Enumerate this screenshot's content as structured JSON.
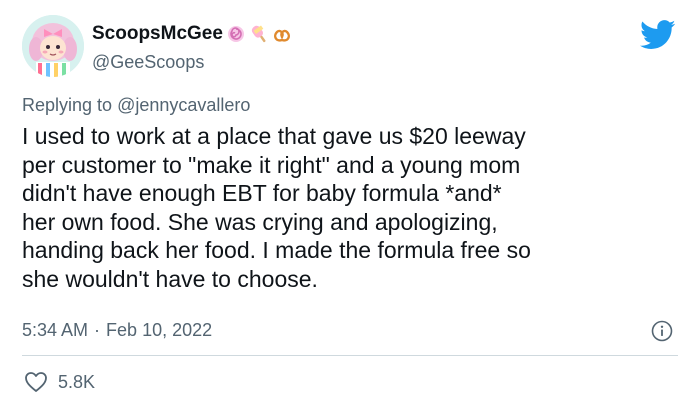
{
  "author": {
    "display_name": "ScoopsMcGee",
    "handle": "@GeeScoops",
    "name_emojis": [
      "lollipop-swirl-icon",
      "ice-pop-icon",
      "pretzel-icon"
    ]
  },
  "reply": {
    "prefix": "Replying to",
    "mention": "@jennycavallero"
  },
  "tweet": {
    "text": "I used to work at a place that gave us $20 leeway\nper customer to \"make it right\" and a young mom\ndidn't have enough EBT for baby formula *and*\nher own food. She was crying and apologizing,\nhanding back her food. I made the formula free so\nshe wouldn't have to choose.",
    "time": "5:34 AM",
    "separator": "·",
    "date": "Feb 10, 2022"
  },
  "engagement": {
    "likes": "5.8K"
  },
  "colors": {
    "text": "#0f1419",
    "secondary": "#536471",
    "twitter_blue": "#1d9bf0",
    "divider": "#cfd9de"
  }
}
